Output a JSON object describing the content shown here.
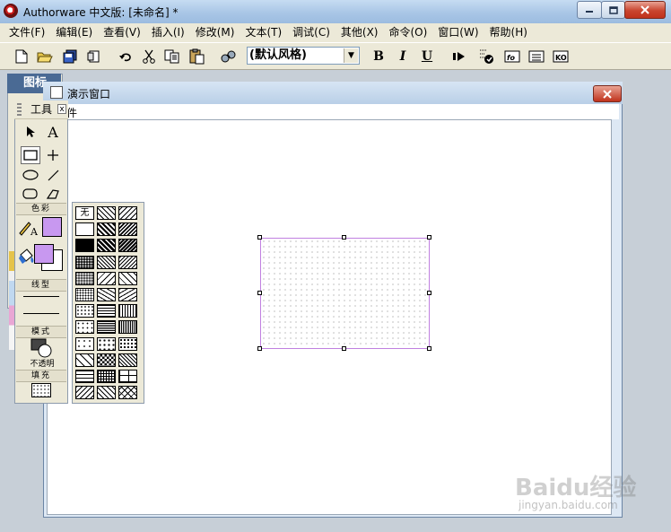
{
  "app": {
    "title": "Authorware 中文版: [未命名] *"
  },
  "menubar": {
    "items": [
      "文件(F)",
      "编辑(E)",
      "查看(V)",
      "插入(I)",
      "修改(M)",
      "文本(T)",
      "调试(C)",
      "其他(X)",
      "命令(O)",
      "窗口(W)",
      "帮助(H)"
    ]
  },
  "toolbar": {
    "style_combo_value": "(默认风格)",
    "bold_label": "B",
    "italic_label": "I",
    "underline_label": "U"
  },
  "icons_panel": {
    "title": "图标"
  },
  "presentation_window": {
    "title": "演示窗口",
    "menu_item": "件"
  },
  "tools_panel": {
    "title": "工具",
    "close_label": "x",
    "section_color": "色彩",
    "section_linetype": "线型",
    "section_mode": "模式",
    "mode_value": "不透明",
    "section_fill": "填充",
    "text_tool_label": "A"
  },
  "fill_palette": {
    "none_label": "无"
  },
  "colors": {
    "selected_color": "#c898f0",
    "rect_border": "#c080e0"
  },
  "watermark": {
    "text": "Baidu经验",
    "sub": "jingyan.baidu.com"
  }
}
